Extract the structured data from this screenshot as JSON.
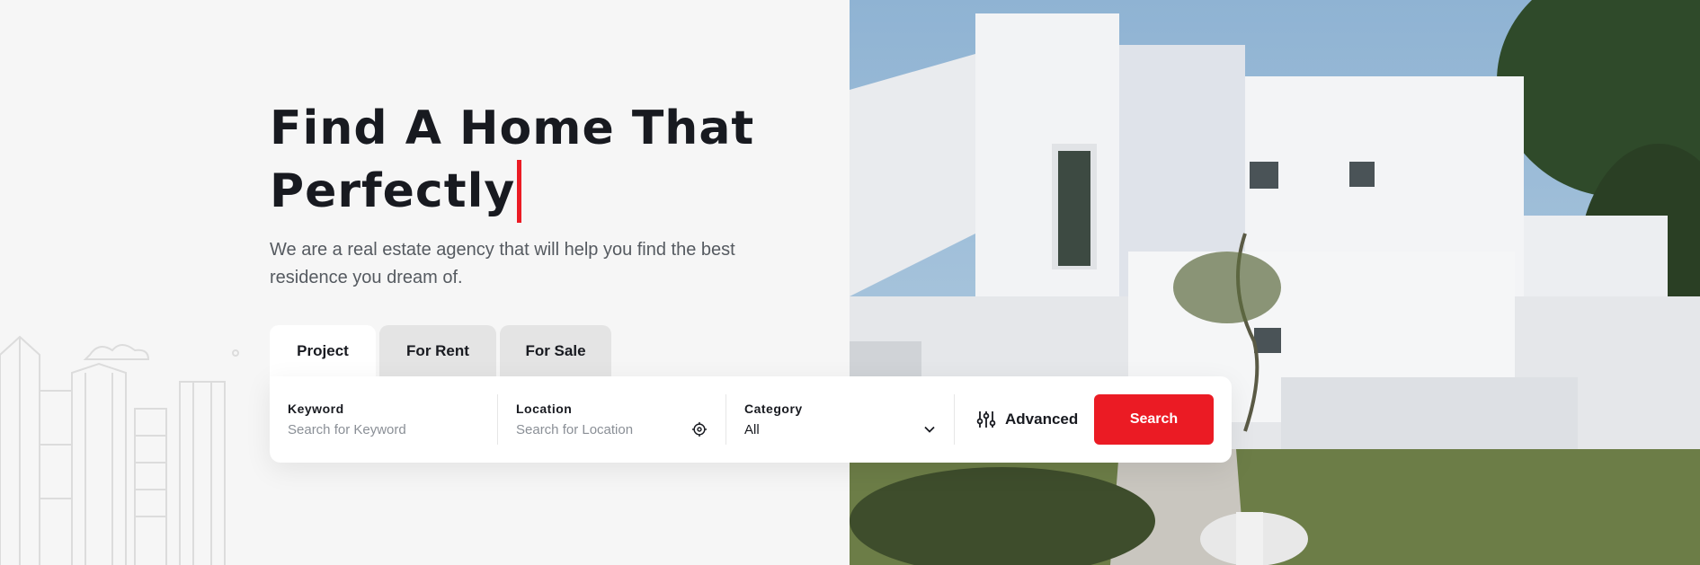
{
  "hero": {
    "headline_line1": "Find A Home That",
    "headline_line2": "Perfectly",
    "subtitle": "We are a real estate agency that will help you find the best residence you dream of."
  },
  "tabs": [
    {
      "label": "Project",
      "active": true
    },
    {
      "label": "For Rent",
      "active": false
    },
    {
      "label": "For Sale",
      "active": false
    }
  ],
  "search": {
    "keyword_label": "Keyword",
    "keyword_placeholder": "Search for Keyword",
    "location_label": "Location",
    "location_placeholder": "Search for Location",
    "category_label": "Category",
    "category_value": "All",
    "advanced_label": "Advanced",
    "search_button": "Search"
  },
  "icons": {
    "location": "crosshair-icon",
    "category": "chevron-down-icon",
    "advanced": "sliders-icon"
  },
  "colors": {
    "accent": "#eb1b24",
    "text": "#181a20",
    "background": "#f6f6f6"
  }
}
